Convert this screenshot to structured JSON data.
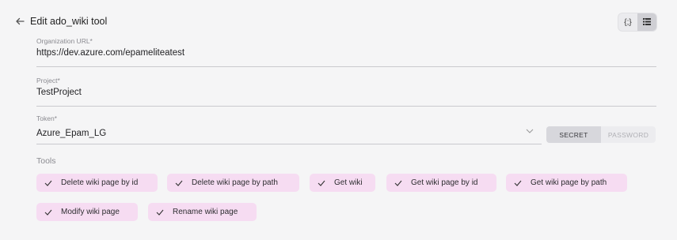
{
  "header": {
    "title": "Edit ado_wiki tool",
    "back_icon": "arrow-left-icon",
    "view_toggle": [
      "json-view-icon",
      "form-view-icon"
    ],
    "view_toggle_glyph": "{;}"
  },
  "fields": {
    "organization_url": {
      "label": "Organization URL*",
      "value": "https://dev.azure.com/epameliteatest"
    },
    "project": {
      "label": "Project*",
      "value": "TestProject"
    },
    "token": {
      "label": "Token*",
      "value": "Azure_Epam_LG"
    }
  },
  "token_mode": {
    "options": [
      "SECRET",
      "PASSWORD"
    ],
    "selected": "SECRET"
  },
  "tools": {
    "label": "Tools",
    "items": [
      "Delete wiki page by id",
      "Delete wiki page by path",
      "Get wiki",
      "Get wiki page by id",
      "Get wiki page by path",
      "Modify wiki page",
      "Rename wiki page"
    ]
  },
  "colors": {
    "chip_bg": "#f6dcf2",
    "background": "#f5f5f6"
  }
}
